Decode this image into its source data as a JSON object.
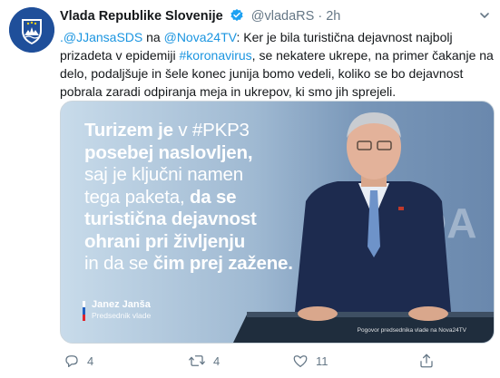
{
  "account": {
    "name": "Vlada Republike Slovenije",
    "handle": "@vladaRS",
    "separator": "·",
    "time": "2h",
    "avatar_icon": "coat-of-arms"
  },
  "tweet": {
    "mention1": ".@JJansaSDS",
    "word_na": " na ",
    "mention2": "@Nova24TV",
    "text_part1": ": Ker je bila turistična dejavnost najbolj prizadeta v epidemiji ",
    "hashtag": "#koronavirus",
    "text_part2": ", se nekatere ukrepe, na primer čakanje na delo, podaljšuje in šele konec junija bomo vedeli, koliko se bo dejavnost pobrala zaradi odpiranja meja in ukrepov, ki smo jih sprejeli."
  },
  "media": {
    "quote": {
      "l1a": "Turizem je",
      "l1b": " v #PKP3",
      "l2": "posebej naslovljen,",
      "l3": "saj je ključni namen",
      "l4a": "tega paketa, ",
      "l4b": "da se",
      "l5": "turistična dejavnost",
      "l6": "ohrani pri življenju",
      "l7a": "in da se ",
      "l7b": "čim prej zažene."
    },
    "signature_name": "Janez Janša",
    "signature_role": "Predsednik vlade",
    "photo_credit": "Pogovor predsednika vlade na Nova24TV",
    "backdrop_text": "VLADA"
  },
  "actions": {
    "reply_count": "4",
    "retweet_count": "4",
    "like_count": "11"
  },
  "colors": {
    "link": "#1b95e0",
    "verified": "#1da1f2",
    "secondary_text": "#657786"
  }
}
